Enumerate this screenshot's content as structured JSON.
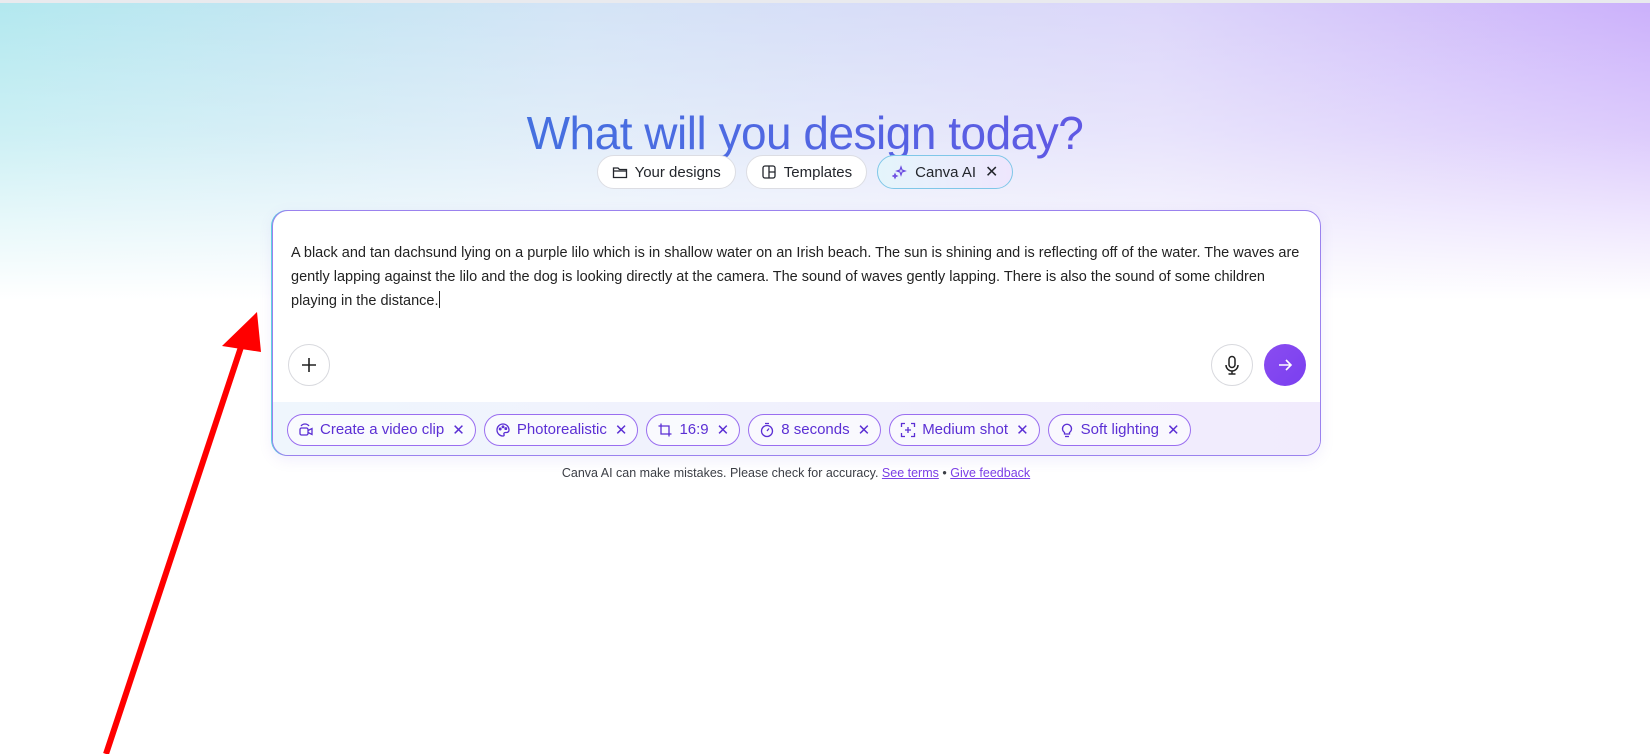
{
  "hero": {
    "title": "What will you design today?"
  },
  "tabs": [
    {
      "label": "Your designs",
      "icon": "folder-icon"
    },
    {
      "label": "Templates",
      "icon": "template-icon"
    },
    {
      "label": "Canva AI",
      "icon": "sparkle-icon",
      "active": true,
      "close": "✕"
    }
  ],
  "prompt": {
    "text": "A black and tan  dachsund lying on a purple lilo which is in shallow water on an Irish beach. The sun is shining and is reflecting off of the water. The waves are gently lapping against the lilo and the dog is looking directly at the camera. The sound of waves gently lapping. There is also the sound of some children playing in the distance."
  },
  "chips": [
    {
      "label": "Create a video clip",
      "icon": "video-clip-icon"
    },
    {
      "label": "Photorealistic",
      "icon": "palette-icon"
    },
    {
      "label": "16:9",
      "icon": "crop-icon"
    },
    {
      "label": "8 seconds",
      "icon": "timer-icon"
    },
    {
      "label": "Medium shot",
      "icon": "frame-icon"
    },
    {
      "label": "Soft lighting",
      "icon": "lightbulb-icon"
    }
  ],
  "chip_close": "✕",
  "disclaimer": {
    "text": "Canva AI can make mistakes. Please check for accuracy.",
    "terms_link": "See terms",
    "separator": "•",
    "feedback_link": "Give feedback"
  },
  "colors": {
    "accent": "#7b3fe6",
    "chip_border": "#9a6ef0",
    "annotation_arrow": "#ff0000"
  }
}
